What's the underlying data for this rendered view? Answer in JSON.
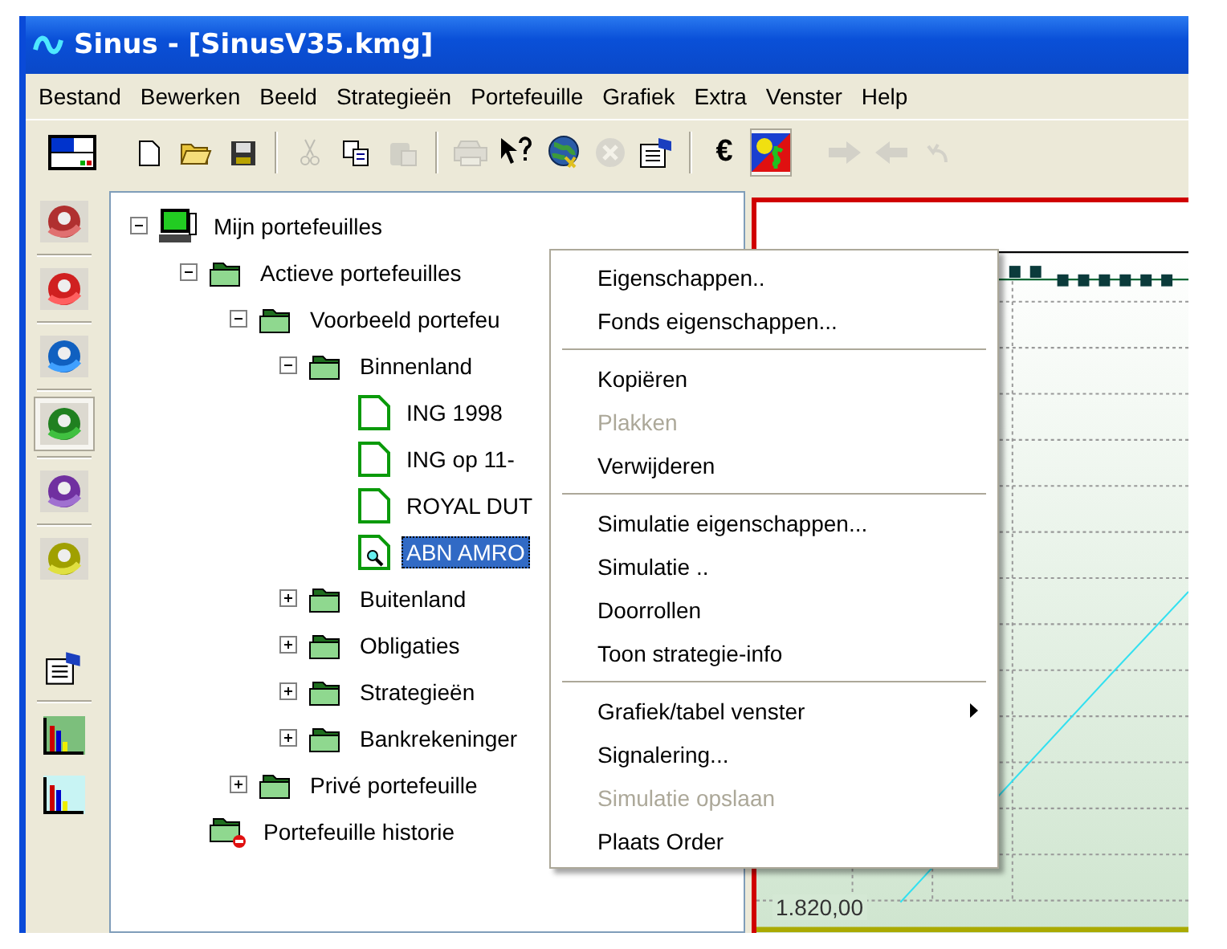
{
  "window": {
    "title": "Sinus - [SinusV35.kmg]"
  },
  "menu_bar": [
    "Bestand",
    "Bewerken",
    "Beeld",
    "Strategieën",
    "Portefeuille",
    "Grafiek",
    "Extra",
    "Venster",
    "Help"
  ],
  "toolbar": [
    {
      "kind": "button",
      "disabled": false,
      "pressed": false
    },
    {
      "kind": "gap"
    },
    {
      "kind": "button",
      "disabled": false,
      "pressed": false
    },
    {
      "kind": "button",
      "disabled": false,
      "pressed": false
    },
    {
      "kind": "button",
      "disabled": false,
      "pressed": false
    },
    {
      "kind": "separator"
    },
    {
      "kind": "button",
      "disabled": true,
      "pressed": false
    },
    {
      "kind": "button",
      "disabled": false,
      "pressed": false
    },
    {
      "kind": "button",
      "disabled": true,
      "pressed": false
    },
    {
      "kind": "separator"
    },
    {
      "kind": "button",
      "disabled": true,
      "pressed": false
    },
    {
      "kind": "button",
      "disabled": false,
      "pressed": false
    },
    {
      "kind": "button",
      "disabled": false,
      "pressed": false
    },
    {
      "kind": "button",
      "disabled": true,
      "pressed": false
    },
    {
      "kind": "button",
      "disabled": false,
      "pressed": false
    },
    {
      "kind": "separator"
    },
    {
      "kind": "text",
      "label": "€",
      "disabled": false,
      "pressed": false
    },
    {
      "kind": "button",
      "disabled": false,
      "pressed": true
    },
    {
      "kind": "gap"
    },
    {
      "kind": "button",
      "disabled": true,
      "pressed": false
    },
    {
      "kind": "button",
      "disabled": true,
      "pressed": false
    },
    {
      "kind": "button",
      "disabled": true,
      "pressed": false
    }
  ],
  "side_toolbar": [
    {
      "kind": "button",
      "pressed": false
    },
    {
      "kind": "separator"
    },
    {
      "kind": "button",
      "pressed": false
    },
    {
      "kind": "separator"
    },
    {
      "kind": "button",
      "pressed": false
    },
    {
      "kind": "separator"
    },
    {
      "kind": "button",
      "pressed": true
    },
    {
      "kind": "separator"
    },
    {
      "kind": "button",
      "pressed": false
    },
    {
      "kind": "separator"
    },
    {
      "kind": "button",
      "pressed": false
    },
    {
      "kind": "gap"
    },
    {
      "kind": "button",
      "pressed": false
    },
    {
      "kind": "separator"
    },
    {
      "kind": "button",
      "pressed": false
    },
    {
      "kind": "button",
      "pressed": false
    }
  ],
  "tree": [
    {
      "label": "Mijn portefeuilles",
      "kind": "computer",
      "expanded": true,
      "selected": false,
      "children": [
        {
          "label": "Actieve portefeuilles",
          "kind": "folder",
          "expanded": true,
          "selected": false,
          "children": [
            {
              "label": "Voorbeeld portefeu",
              "kind": "folder",
              "expanded": true,
              "selected": false,
              "children": [
                {
                  "label": "Binnenland",
                  "kind": "folder",
                  "expanded": true,
                  "selected": false,
                  "children": [
                    {
                      "label": "ING 1998",
                      "kind": "document",
                      "selected": false
                    },
                    {
                      "label": "ING op 11-",
                      "kind": "document",
                      "selected": false
                    },
                    {
                      "label": "ROYAL DUT",
                      "kind": "document",
                      "selected": false
                    },
                    {
                      "label": "ABN AMRO",
                      "kind": "document-search",
                      "selected": true
                    }
                  ]
                },
                {
                  "label": "Buitenland",
                  "kind": "folder",
                  "expanded": false,
                  "selected": false
                },
                {
                  "label": "Obligaties",
                  "kind": "folder",
                  "expanded": false,
                  "selected": false
                },
                {
                  "label": "Strategieën",
                  "kind": "folder",
                  "expanded": false,
                  "selected": false
                },
                {
                  "label": "Bankrekeninger",
                  "kind": "folder",
                  "expanded": false,
                  "selected": false
                }
              ]
            },
            {
              "label": "Privé portefeuille",
              "kind": "folder",
              "expanded": false,
              "selected": false
            }
          ]
        },
        {
          "label": "Portefeuille historie",
          "kind": "folder-history",
          "selected": false
        }
      ]
    }
  ],
  "chart": {
    "axis_label": "1.820,00"
  },
  "context_menu": [
    [
      {
        "label": "Eigenschappen..",
        "disabled": false,
        "submenu": false
      },
      {
        "label": "Fonds eigenschappen...",
        "disabled": false,
        "submenu": false
      }
    ],
    [
      {
        "label": "Kopiëren",
        "disabled": false,
        "submenu": false
      },
      {
        "label": "Plakken",
        "disabled": true,
        "submenu": false
      },
      {
        "label": "Verwijderen",
        "disabled": false,
        "submenu": false
      }
    ],
    [
      {
        "label": "Simulatie eigenschappen...",
        "disabled": false,
        "submenu": false
      },
      {
        "label": "Simulatie ..",
        "disabled": false,
        "submenu": false
      },
      {
        "label": "Doorrollen",
        "disabled": false,
        "submenu": false
      },
      {
        "label": "Toon strategie-info",
        "disabled": false,
        "submenu": false
      }
    ],
    [
      {
        "label": "Grafiek/tabel venster",
        "disabled": false,
        "submenu": true
      },
      {
        "label": "Signalering...",
        "disabled": false,
        "submenu": false
      },
      {
        "label": "Simulatie opslaan",
        "disabled": true,
        "submenu": false
      },
      {
        "label": "Plaats Order",
        "disabled": false,
        "submenu": false
      }
    ]
  ]
}
